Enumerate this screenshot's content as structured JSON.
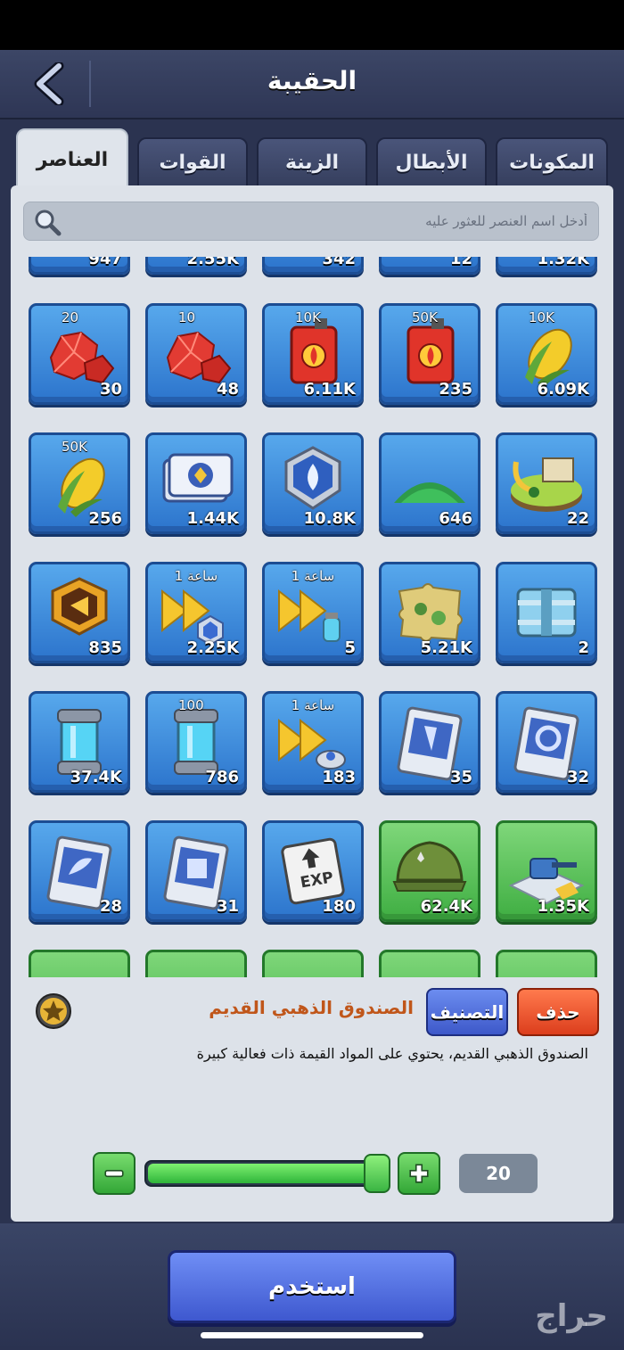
{
  "header": {
    "title": "الحقيبة"
  },
  "tabs": [
    {
      "label": "العناصر",
      "active": true
    },
    {
      "label": "القوات",
      "active": false
    },
    {
      "label": "الزينة",
      "active": false
    },
    {
      "label": "الأبطال",
      "active": false
    },
    {
      "label": "المكونات",
      "active": false
    }
  ],
  "search": {
    "placeholder": "أدخل اسم العنصر للعثور عليه"
  },
  "partial_top_row": [
    {
      "count": "947"
    },
    {
      "count": "2.55K"
    },
    {
      "count": "342"
    },
    {
      "count": "12"
    },
    {
      "count": "1.32K"
    }
  ],
  "grid": [
    [
      {
        "icon": "red-gem-icon",
        "badge": "20",
        "count": "30",
        "color": "blue"
      },
      {
        "icon": "red-gem-icon",
        "badge": "10",
        "count": "48",
        "color": "blue"
      },
      {
        "icon": "fuel-can-icon",
        "badge": "10K",
        "count": "6.11K",
        "color": "blue"
      },
      {
        "icon": "fuel-can-icon",
        "badge": "50K",
        "count": "235",
        "color": "blue"
      },
      {
        "icon": "corn-icon",
        "badge": "10K",
        "count": "6.09K",
        "color": "blue"
      }
    ],
    [
      {
        "icon": "corn-icon",
        "badge": "50K",
        "count": "256",
        "color": "blue"
      },
      {
        "icon": "emblem-cards-icon",
        "badge": "",
        "count": "1.44K",
        "color": "blue"
      },
      {
        "icon": "water-emblem-icon",
        "badge": "",
        "count": "10.8K",
        "color": "blue"
      },
      {
        "icon": "green-powder-icon",
        "badge": "",
        "count": "646",
        "color": "blue"
      },
      {
        "icon": "island-base-icon",
        "badge": "",
        "count": "22",
        "color": "blue"
      }
    ],
    [
      {
        "icon": "gold-medal-icon",
        "badge": "",
        "count": "835",
        "color": "blue"
      },
      {
        "icon": "speedup-hex-icon",
        "badge": "1 ساعة",
        "count": "2.25K",
        "color": "blue"
      },
      {
        "icon": "speedup-potion-icon",
        "badge": "1 ساعة",
        "count": "5",
        "color": "blue"
      },
      {
        "icon": "map-piece-icon",
        "badge": "",
        "count": "5.21K",
        "color": "blue"
      },
      {
        "icon": "crate-icon",
        "badge": "",
        "count": "2",
        "color": "blue"
      }
    ],
    [
      {
        "icon": "energy-cell-icon",
        "badge": "",
        "count": "37.4K",
        "color": "blue"
      },
      {
        "icon": "energy-cell-icon",
        "badge": "100",
        "count": "786",
        "color": "blue"
      },
      {
        "icon": "speedup-timer-icon",
        "badge": "1 ساعة",
        "count": "183",
        "color": "blue"
      },
      {
        "icon": "drill-blueprint-icon",
        "badge": "",
        "count": "35",
        "color": "blue"
      },
      {
        "icon": "gear-blueprint-icon",
        "badge": "",
        "count": "32",
        "color": "blue"
      }
    ],
    [
      {
        "icon": "radar-blueprint-icon",
        "badge": "",
        "count": "28",
        "color": "blue"
      },
      {
        "icon": "factory-blueprint-icon",
        "badge": "",
        "count": "31",
        "color": "blue"
      },
      {
        "icon": "exp-card-icon",
        "badge": "",
        "count": "180",
        "color": "blue"
      },
      {
        "icon": "army-helmet-icon",
        "badge": "",
        "count": "62.4K",
        "color": "green"
      },
      {
        "icon": "turret-icon",
        "badge": "",
        "count": "1.35K",
        "color": "green"
      }
    ]
  ],
  "partial_bottom_row": [
    {
      "color": "green"
    },
    {
      "color": "green"
    },
    {
      "color": "green"
    },
    {
      "color": "green"
    },
    {
      "color": "green"
    }
  ],
  "selected": {
    "name": "الصندوق الذهبي القديم",
    "description": "الصندوق الذهبي القديم، يحتوي على المواد القيمة ذات فعالية كبيرة",
    "sort_label": "التصنيف",
    "delete_label": "حذف"
  },
  "quantity": {
    "value": "20",
    "fill_fraction": 1.0,
    "minus": "−",
    "plus": "+"
  },
  "use_button": "استخدم",
  "watermark": "حراج",
  "colors": {
    "tile_blue": "#3a8ce0",
    "tile_green": "#4fbf4f",
    "accent_orange": "#c0561a"
  }
}
